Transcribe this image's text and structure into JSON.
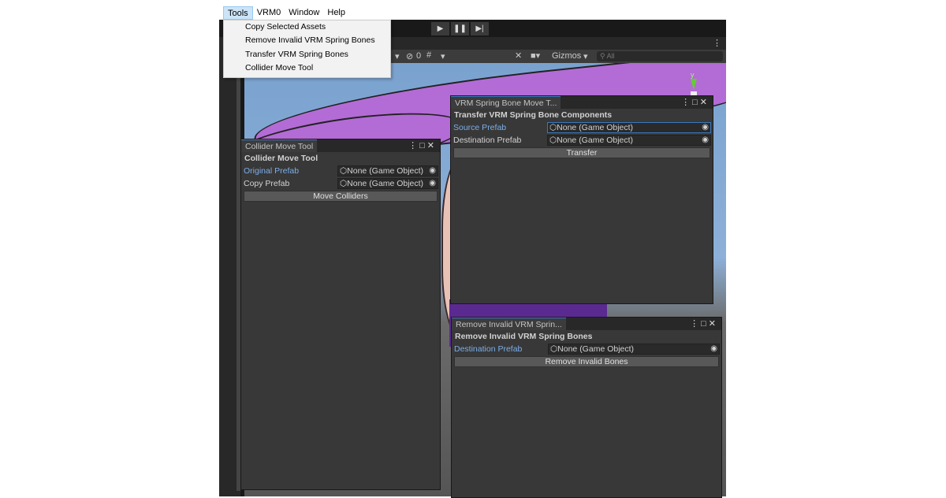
{
  "menubar": {
    "items": [
      "Tools",
      "VRM0",
      "Window",
      "Help"
    ]
  },
  "tools_menu": {
    "items": [
      "Copy Selected Assets",
      "Remove Invalid VRM Spring Bones",
      "Transfer VRM Spring Bones",
      "Collider Move Tool"
    ]
  },
  "playbar": {
    "play": "▶",
    "pause": "❚❚",
    "step": "▶|"
  },
  "scene_toolbar": {
    "hidden_count": "0",
    "gizmos": "Gizmos",
    "search_placeholder": "All"
  },
  "gizmo_axis": "y",
  "collider_window": {
    "tab": "Collider Move Tool",
    "header": "Collider Move Tool",
    "fields": [
      {
        "label": "Original Prefab",
        "value": "None (Game Object)"
      },
      {
        "label": "Copy Prefab",
        "value": "None (Game Object)"
      }
    ],
    "button": "Move Colliders"
  },
  "transfer_window": {
    "tab": "VRM Spring Bone Move T...",
    "header": "Transfer VRM Spring Bone Components",
    "fields": [
      {
        "label": "Source Prefab",
        "value": "None (Game Object)"
      },
      {
        "label": "Destination Prefab",
        "value": "None (Game Object)"
      }
    ],
    "button": "Transfer"
  },
  "remove_window": {
    "tab": "Remove Invalid VRM Sprin...",
    "header": "Remove Invalid VRM Spring Bones",
    "fields": [
      {
        "label": "Destination Prefab",
        "value": "None (Game Object)"
      }
    ],
    "button": "Remove Invalid Bones"
  }
}
